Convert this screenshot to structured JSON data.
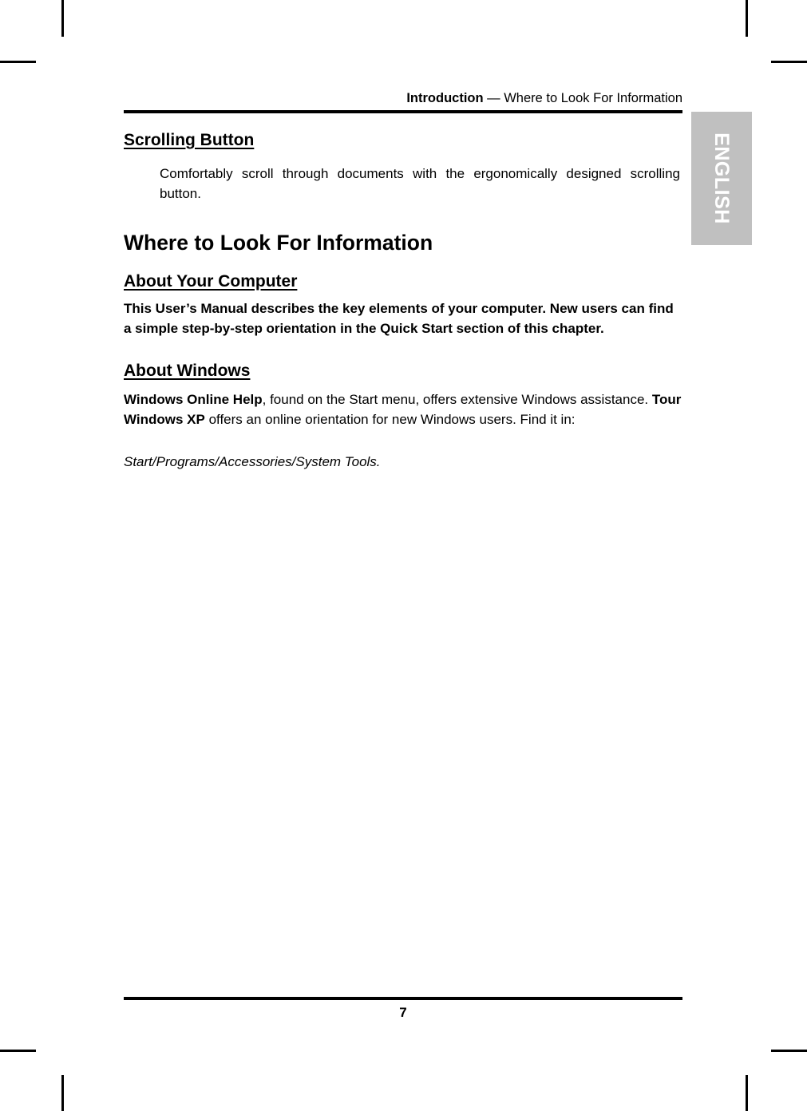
{
  "header": {
    "chapter": "Introduction",
    "separator_and_section": " — Where to Look For Information"
  },
  "side_tab": {
    "label": "ENGLISH",
    "background_color": "#c0c0c0",
    "text_color": "#ffffff"
  },
  "sections": {
    "scrolling_button": {
      "heading": "Scrolling Button",
      "body": "Comfortably scroll through documents with the ergonomically designed scrolling button."
    },
    "where_to_look": {
      "heading": "Where to Look For Information"
    },
    "about_your_computer": {
      "heading": "About Your Computer",
      "body": "This User’s Manual describes the key elements of your computer. New users can find a simple step-by-step orientation in the Quick Start section of this chapter."
    },
    "about_windows": {
      "heading": "About Windows",
      "body_part1_bold": "Windows Online Help",
      "body_part2": ", found on the Start menu, offers extensive Windows assistance. ",
      "body_part3_bold": "Tour Windows XP",
      "body_part4": " offers an online orientation for new Windows users. Find it in:",
      "path": "Start/Programs/Accessories/System Tools."
    }
  },
  "footer": {
    "page_number": "7"
  }
}
